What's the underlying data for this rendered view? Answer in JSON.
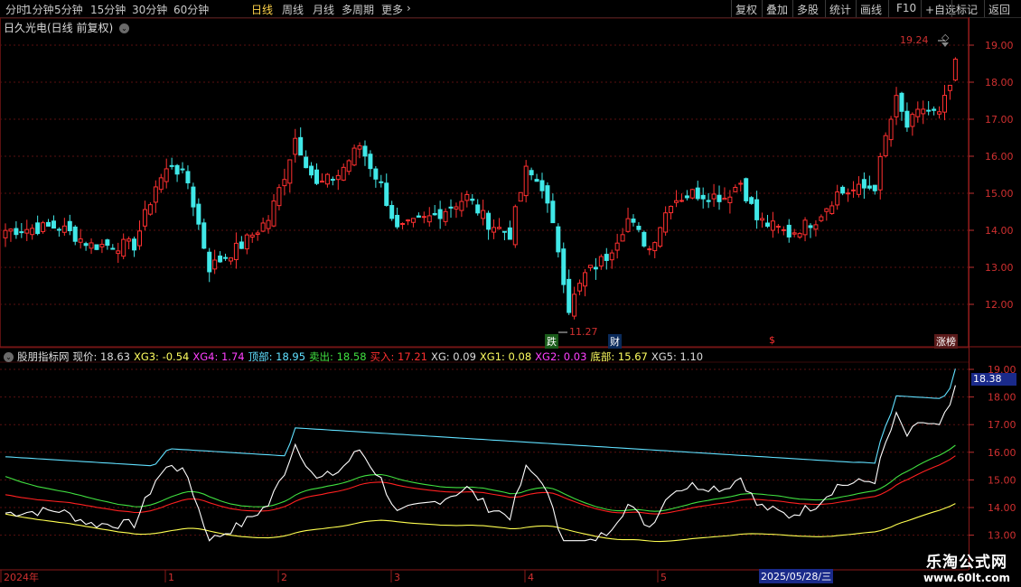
{
  "toolbar": {
    "left": [
      {
        "label": "分时",
        "active": false
      },
      {
        "label": "1分钟",
        "active": false
      },
      {
        "label": "5分钟",
        "active": false
      },
      {
        "label": "15分钟",
        "active": false
      },
      {
        "label": "30分钟",
        "active": false
      },
      {
        "label": "60分钟",
        "active": false
      },
      {
        "label": "日线",
        "active": true
      },
      {
        "label": "周线",
        "active": false
      },
      {
        "label": "月线",
        "active": false
      },
      {
        "label": "多周期",
        "active": false
      },
      {
        "label": "更多",
        "active": false
      }
    ],
    "right": [
      "复权",
      "叠加",
      "多股",
      "统计",
      "画线",
      "F10",
      "+自选",
      "标记",
      "返回"
    ]
  },
  "stock": {
    "title": "日久光电(日线 前复权)"
  },
  "price_axis": [
    "19.00",
    "18.00",
    "17.00",
    "16.00",
    "15.00",
    "14.00",
    "13.00",
    "12.00"
  ],
  "price_annotations": {
    "high": "19.24",
    "low": "11.27"
  },
  "event_tags": [
    {
      "label": "跌",
      "bg": "#1a5c1a",
      "color": "#ffffff"
    },
    {
      "label": "财",
      "bg": "#0a2a5a",
      "color": "#ffffff"
    },
    {
      "label": "$",
      "bg": "",
      "color": "#ff3030"
    },
    {
      "label": "涨榜",
      "bg": "#5a1a1a",
      "color": "#ffffff"
    }
  ],
  "indicator": {
    "name": "股朋指标网",
    "fields": [
      {
        "label": "现价:",
        "value": "18.63",
        "color": "#dcdcdc"
      },
      {
        "label": "XG3:",
        "value": "-0.54",
        "color": "#ffff60"
      },
      {
        "label": "XG4:",
        "value": "1.74",
        "color": "#ff40ff"
      },
      {
        "label": "顶部:",
        "value": "18.95",
        "color": "#60e0ff"
      },
      {
        "label": "卖出:",
        "value": "18.58",
        "color": "#40e040"
      },
      {
        "label": "买入:",
        "value": "17.21",
        "color": "#ff3030"
      },
      {
        "label": "XG:",
        "value": "0.09",
        "color": "#dcdcdc"
      },
      {
        "label": "XG1:",
        "value": "0.08",
        "color": "#ffff60"
      },
      {
        "label": "XG2:",
        "value": "0.03",
        "color": "#ff40ff"
      },
      {
        "label": "底部:",
        "value": "15.67",
        "color": "#ffff60"
      },
      {
        "label": "XG5:",
        "value": "1.10",
        "color": "#dcdcdc"
      }
    ]
  },
  "indicator_axis": [
    "19.00",
    "18.00",
    "17.00",
    "16.00",
    "15.00",
    "14.00",
    "13.00"
  ],
  "indicator_current": "18.38",
  "date_axis": [
    "2024年",
    "1",
    "2",
    "3",
    "4",
    "5"
  ],
  "date_selected": "2025/05/28/三",
  "watermark": {
    "line1": "乐淘公式网",
    "line2": "www.60lt.com"
  },
  "colors": {
    "up": "#ff3030",
    "down": "#40e8e8",
    "grid": "#5a1010"
  }
}
